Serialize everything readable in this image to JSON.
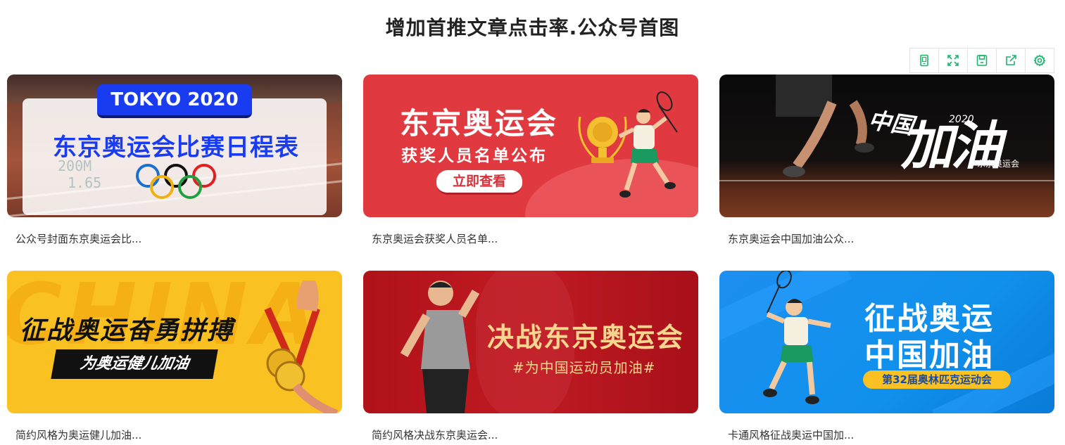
{
  "page": {
    "title": "增加首推文章点击率.公众号首图"
  },
  "toolbar": {
    "icons": [
      "phone-icon",
      "expand-icon",
      "save-icon",
      "share-icon",
      "settings-icon"
    ],
    "accent": "#19b36b"
  },
  "cards": [
    {
      "caption": "公众号封面东京奥运会比...",
      "banner": "TOKYO 2020",
      "headline": "东京奥运会比赛日程表",
      "track_text": [
        "200M",
        "1.65"
      ]
    },
    {
      "caption": "东京奥运会获奖人员名单...",
      "headline": "东京奥运会",
      "subtitle": "获奖人员名单公布",
      "button": "立即查看"
    },
    {
      "caption": "东京奥运会中国加油公众...",
      "small": "中国",
      "big": "加油",
      "year": "2020",
      "sub": "东京奥运会"
    },
    {
      "caption": "简约风格为奥运健儿加油...",
      "headline": "征战奥运奋勇拼搏",
      "subtitle": "为奥运健儿加油",
      "bg_text": "CHINA"
    },
    {
      "caption": "简约风格决战东京奥运会...",
      "headline": "决战东京奥运会",
      "subtitle": "#为中国运动员加油#"
    },
    {
      "caption": "卡通风格征战奥运中国加...",
      "line1": "征战奥运",
      "line2": "中国加油",
      "badge": "第32届奥林匹克运动会"
    }
  ]
}
